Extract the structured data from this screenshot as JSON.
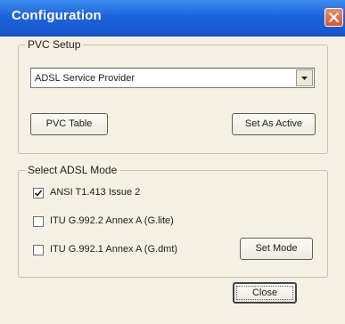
{
  "window": {
    "title": "Configuration",
    "accent_color": "#1c63dc",
    "close_icon": "close-icon"
  },
  "pvc_setup": {
    "legend": "PVC Setup",
    "provider_select": {
      "value": "ADSL Service Provider"
    },
    "pvc_table_label": "PVC Table",
    "set_as_active_label": "Set As Active"
  },
  "adsl_mode": {
    "legend": "Select ADSL Mode",
    "options": [
      {
        "label": "ANSI T1.413 Issue 2",
        "checked": true
      },
      {
        "label": "ITU G.992.2 Annex A (G.lite)",
        "checked": false
      },
      {
        "label": "ITU G.992.1 Annex A (G.dmt)",
        "checked": false
      }
    ],
    "set_mode_label": "Set Mode"
  },
  "footer": {
    "close_label": "Close"
  }
}
